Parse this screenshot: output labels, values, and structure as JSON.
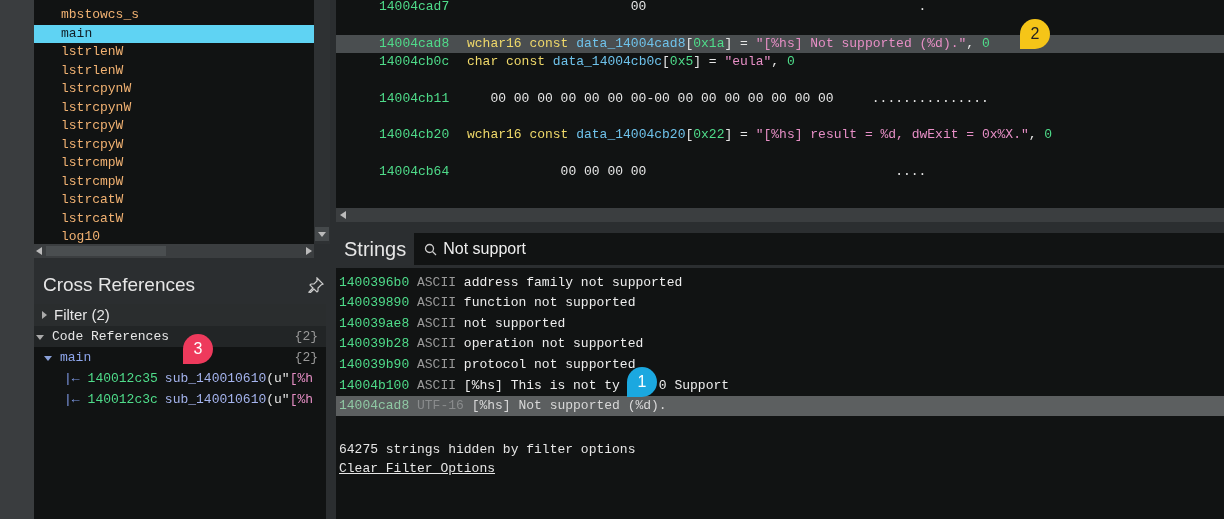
{
  "functions": {
    "items": [
      {
        "label": "mbstowcs_s",
        "selected": false
      },
      {
        "label": "main",
        "selected": true
      },
      {
        "label": "lstrlenW",
        "selected": false
      },
      {
        "label": "lstrlenW",
        "selected": false
      },
      {
        "label": "lstrcpynW",
        "selected": false
      },
      {
        "label": "lstrcpynW",
        "selected": false
      },
      {
        "label": "lstrcpyW",
        "selected": false
      },
      {
        "label": "lstrcpyW",
        "selected": false
      },
      {
        "label": "lstrcmpW",
        "selected": false
      },
      {
        "label": "lstrcmpW",
        "selected": false
      },
      {
        "label": "lstrcatW",
        "selected": false
      },
      {
        "label": "lstrcatW",
        "selected": false
      },
      {
        "label": "log10",
        "selected": false
      }
    ]
  },
  "cross_references": {
    "title": "Cross References",
    "filter": {
      "label": "Filter (2)",
      "expanded": false
    },
    "code_references": {
      "label": "Code References",
      "count": "{2}",
      "expanded": true,
      "children": [
        {
          "label": "main",
          "count": "{2}",
          "expanded": true,
          "children": [
            {
              "arrow": "|←",
              "address": "140012c35",
              "call": "sub_140010610",
              "open": "(u\"",
              "string": "[%h"
            },
            {
              "arrow": "|←",
              "address": "140012c3c",
              "call": "sub_140010610",
              "open": "(u\"",
              "string": "[%h"
            }
          ]
        }
      ]
    }
  },
  "listing": [
    {
      "kind": "hex",
      "address": "14004cad7",
      "bytes": "00",
      "ascii": ".",
      "selected": false
    },
    {
      "kind": "blank"
    },
    {
      "kind": "data",
      "address": "14004cad8",
      "selected": true,
      "tokens": [
        {
          "color": "#f0d96a",
          "text": "wchar16 const "
        },
        {
          "color": "#6fc3ec",
          "text": "data_14004cad8"
        },
        {
          "text": "["
        },
        {
          "color": "#4fdc8a",
          "text": "0x1a"
        },
        {
          "text": "] = "
        },
        {
          "color": "#e78fc6",
          "text": "\"[%hs] Not supported (%d).\""
        },
        {
          "text": ", "
        },
        {
          "color": "#4fdc8a",
          "text": "0"
        }
      ]
    },
    {
      "kind": "data",
      "address": "14004cb0c",
      "selected": false,
      "tokens": [
        {
          "color": "#f0d96a",
          "text": "char const "
        },
        {
          "color": "#6fc3ec",
          "text": "data_14004cb0c"
        },
        {
          "text": "["
        },
        {
          "color": "#4fdc8a",
          "text": "0x5"
        },
        {
          "text": "] = "
        },
        {
          "color": "#e78fc6",
          "text": "\"eula\""
        },
        {
          "text": ", "
        },
        {
          "color": "#4fdc8a",
          "text": "0"
        }
      ]
    },
    {
      "kind": "blank"
    },
    {
      "kind": "hex",
      "address": "14004cb11",
      "bytes": "00 00 00 00 00 00 00-00 00 00 00 00 00 00 00",
      "ascii": "...............",
      "selected": false
    },
    {
      "kind": "blank"
    },
    {
      "kind": "data",
      "address": "14004cb20",
      "selected": false,
      "tokens": [
        {
          "color": "#f0d96a",
          "text": "wchar16 const "
        },
        {
          "color": "#6fc3ec",
          "text": "data_14004cb20"
        },
        {
          "text": "["
        },
        {
          "color": "#4fdc8a",
          "text": "0x22"
        },
        {
          "text": "] = "
        },
        {
          "color": "#e78fc6",
          "text": "\"[%hs] result = %d, dwExit = 0x%X.\""
        },
        {
          "text": ", "
        },
        {
          "color": "#4fdc8a",
          "text": "0"
        }
      ]
    },
    {
      "kind": "blank"
    },
    {
      "kind": "hex",
      "address": "14004cb64",
      "bytes": "00 00 00 00",
      "ascii": "....",
      "selected": false
    }
  ],
  "strings": {
    "title": "Strings",
    "search": {
      "value": "Not support"
    },
    "rows": [
      {
        "address": "1400396b0",
        "type": "ASCII",
        "text": "address family not supported",
        "selected": false
      },
      {
        "address": "140039890",
        "type": "ASCII",
        "text": "function not supported",
        "selected": false
      },
      {
        "address": "140039ae8",
        "type": "ASCII",
        "text": "not supported",
        "selected": false
      },
      {
        "address": "140039b28",
        "type": "ASCII",
        "text": "operation not supported",
        "selected": false
      },
      {
        "address": "140039b90",
        "type": "ASCII",
        "text": "protocol not supported",
        "selected": false
      },
      {
        "address": "14004b100",
        "type": "ASCII",
        "text": "[%hs] This is not ty",
        "text_after": "0 Support",
        "selected": false
      },
      {
        "address": "14004cad8",
        "type": "UTF-16",
        "text": "[%hs] Not supported (%d).",
        "selected": true
      }
    ],
    "hidden_note": "64275 strings hidden by filter options",
    "clear_link": "Clear Filter Options"
  },
  "callouts": [
    {
      "label": "1",
      "color": "#1ba8e0"
    },
    {
      "label": "2",
      "color": "#f5c518"
    },
    {
      "label": "3",
      "color": "#ee3a5c"
    }
  ]
}
